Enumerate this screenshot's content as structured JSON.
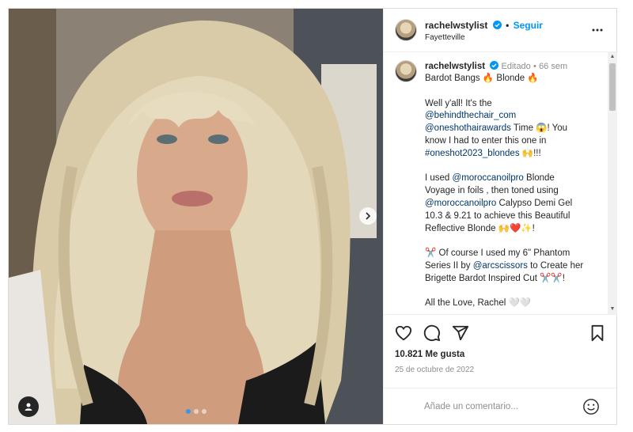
{
  "post": {
    "username": "rachelwstylist",
    "follow_label": "Seguir",
    "separator": "•",
    "location": "Fayetteville",
    "caption": {
      "username": "rachelwstylist",
      "edited_label": "Editado",
      "age": "66 sem",
      "lines": [
        {
          "text": "Bardot Bangs 🔥 Blonde 🔥",
          "type": "text"
        },
        {
          "text": "",
          "type": "text"
        },
        {
          "text": "Well y'all! It's the",
          "type": "text"
        },
        {
          "text": "@behindthechair_com",
          "type": "link"
        },
        {
          "text": "@oneshothairawards",
          "type": "link"
        },
        {
          "text": " Time 😱! You",
          "type": "inline"
        },
        {
          "text": "know I had to enter this one in",
          "type": "text"
        },
        {
          "text": "#oneshot2023_blondes",
          "type": "link"
        },
        {
          "text": " 🙌!!!",
          "type": "inline"
        },
        {
          "text": "",
          "type": "text"
        },
        {
          "text": "I used ",
          "type": "text"
        },
        {
          "text": "@moroccanoilpro",
          "type": "link-inline"
        },
        {
          "text": " Blonde",
          "type": "inline"
        },
        {
          "text": "Voyage in foils , then toned using",
          "type": "text"
        },
        {
          "text": "@moroccanoilpro",
          "type": "link"
        },
        {
          "text": " Calypso Demi Gel",
          "type": "inline"
        },
        {
          "text": "10.3 & 9.21 to achieve this Beautiful",
          "type": "text"
        },
        {
          "text": "Reflective Blonde 🙌❤️✨!",
          "type": "text"
        },
        {
          "text": "",
          "type": "text"
        },
        {
          "text": "✂️ Of course I used my 6\" Phantom",
          "type": "text"
        },
        {
          "text": "Series II by ",
          "type": "text"
        },
        {
          "text": "@arcscissors",
          "type": "link-inline"
        },
        {
          "text": " to Create her",
          "type": "inline"
        },
        {
          "text": "Brigette Bardot Inspired Cut ✂️✂️!",
          "type": "text"
        },
        {
          "text": "",
          "type": "text"
        },
        {
          "text": "All the Love, Rachel 🤍🤍",
          "type": "text"
        }
      ]
    },
    "likes": "10.821 Me gusta",
    "date": "25 de octubre de 2022",
    "comment_placeholder": "Añade un comentario..."
  },
  "icons": {
    "verified": "verified-badge-icon",
    "more": "more-options-icon",
    "like": "heart-icon",
    "comment": "comment-icon",
    "share": "share-icon",
    "save": "bookmark-icon",
    "emoji": "emoji-icon",
    "next": "chevron-right-icon",
    "user_tag": "user-tag-icon"
  },
  "carousel": {
    "count": 3,
    "active_index": 0
  },
  "colors": {
    "accent": "#0095f6",
    "link": "#00376b",
    "muted": "#8e8e8e",
    "text": "#262626",
    "carousel_active": "#3897f0"
  }
}
